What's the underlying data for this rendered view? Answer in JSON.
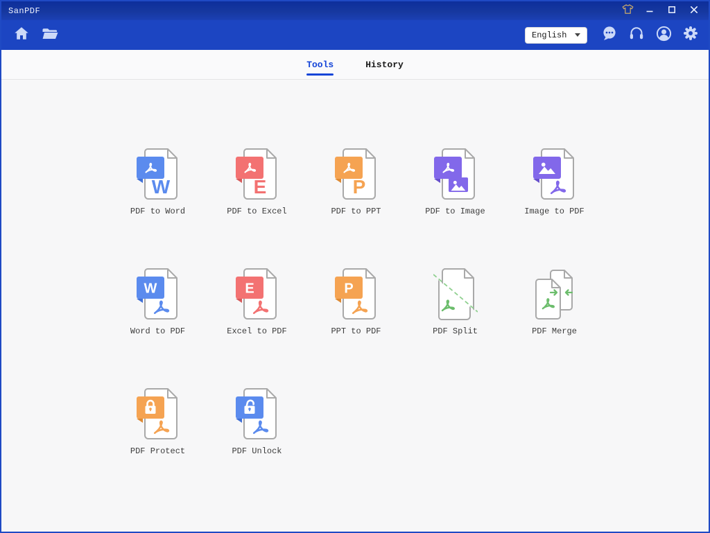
{
  "window": {
    "title": "SanPDF"
  },
  "titlebar": {
    "controls": [
      {
        "name": "theme",
        "icon": "shirt-icon"
      },
      {
        "name": "minimize",
        "icon": "minimize-icon"
      },
      {
        "name": "maximize",
        "icon": "maximize-icon"
      },
      {
        "name": "close",
        "icon": "close-icon"
      }
    ]
  },
  "toolbar": {
    "left_icons": [
      "home-icon",
      "folder-open-icon"
    ],
    "language_selector": {
      "value": "English"
    },
    "right_icons": [
      "chat-icon",
      "headset-icon",
      "user-icon",
      "settings-icon"
    ]
  },
  "tabs": [
    {
      "label": "Tools",
      "active": true
    },
    {
      "label": "History",
      "active": false
    }
  ],
  "tools": [
    {
      "label": "PDF to Word",
      "variant": "standard",
      "badge": "pdf",
      "body": "letter",
      "body_letter": "W",
      "color": "#5b8bee",
      "fold": "#3f6fd6"
    },
    {
      "label": "PDF to Excel",
      "variant": "standard",
      "badge": "pdf",
      "body": "letter",
      "body_letter": "E",
      "color": "#f37272",
      "fold": "#d85a5a"
    },
    {
      "label": "PDF to PPT",
      "variant": "standard",
      "badge": "pdf",
      "body": "letter",
      "body_letter": "P",
      "color": "#f5a352",
      "fold": "#de8a33"
    },
    {
      "label": "PDF to Image",
      "variant": "standard",
      "badge": "pdf",
      "body": "image",
      "color": "#8268ea",
      "fold": "#6750cc"
    },
    {
      "label": "Image to PDF",
      "variant": "standard",
      "badge": "image",
      "body": "pdf",
      "color": "#8268ea",
      "fold": "#6750cc"
    },
    {
      "label": "Word to PDF",
      "variant": "standard",
      "badge": "letter",
      "badge_letter": "W",
      "body": "pdf",
      "color": "#5b8bee",
      "fold": "#3f6fd6"
    },
    {
      "label": "Excel to PDF",
      "variant": "standard",
      "badge": "letter",
      "badge_letter": "E",
      "body": "pdf",
      "color": "#f37272",
      "fold": "#d85a5a"
    },
    {
      "label": "PPT to PDF",
      "variant": "standard",
      "badge": "letter",
      "badge_letter": "P",
      "body": "pdf",
      "color": "#f5a352",
      "fold": "#de8a33"
    },
    {
      "label": "PDF Split",
      "variant": "split",
      "color": "#6cbd6c",
      "dash_color": "#8fd08f"
    },
    {
      "label": "PDF Merge",
      "variant": "merge",
      "color": "#6cbd6c"
    },
    {
      "label": "PDF Protect",
      "variant": "standard",
      "badge": "lock",
      "body": "pdf",
      "color": "#f5a352",
      "fold": "#de8a33"
    },
    {
      "label": "PDF Unlock",
      "variant": "standard",
      "badge": "unlock",
      "body": "pdf",
      "color": "#5b8bee",
      "fold": "#3f6fd6"
    }
  ],
  "colors": {
    "titlebar": "#0d2e9b",
    "toolbar": "#1c45c2",
    "accent": "#1545d8",
    "icon_pale": "#ccd9f8",
    "shirt_gold": "#c9a96b",
    "doc_outline": "#a9a9a9",
    "content_bg": "#f7f7f8"
  }
}
